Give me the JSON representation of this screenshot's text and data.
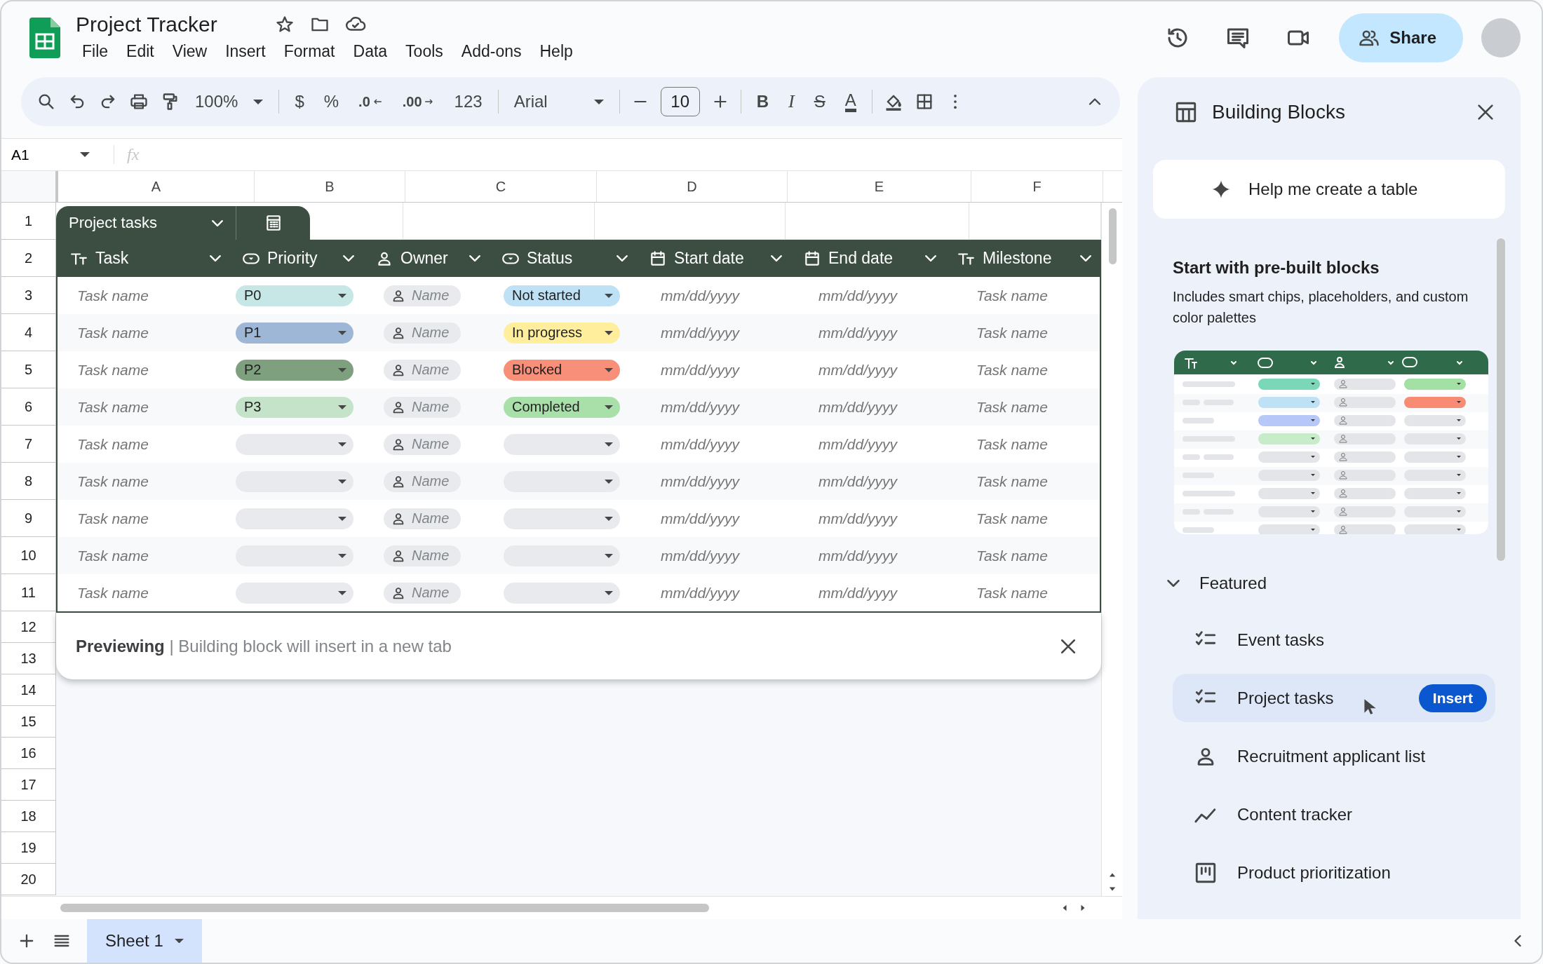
{
  "app": {
    "title": "Project Tracker",
    "menu": [
      "File",
      "Edit",
      "View",
      "Insert",
      "Format",
      "Data",
      "Tools",
      "Add-ons",
      "Help"
    ],
    "share": "Share"
  },
  "toolbar": {
    "zoom": "100%",
    "currency": "$",
    "percent": "%",
    "decrease_decimal": ".0",
    "increase_decimal": ".00",
    "number_format": "123",
    "font": "Arial",
    "font_size": "10",
    "bold": "B",
    "italic": "I",
    "strikethrough": "S",
    "text_color": "A"
  },
  "formula_bar": {
    "cell": "A1",
    "fx": "fx"
  },
  "columns": [
    "A",
    "B",
    "C",
    "D",
    "E",
    "F"
  ],
  "rows": [
    "1",
    "2",
    "3",
    "4",
    "5",
    "6",
    "7",
    "8",
    "9",
    "10",
    "11",
    "12",
    "13",
    "14",
    "15",
    "16",
    "17",
    "18",
    "19",
    "20"
  ],
  "table": {
    "name": "Project tasks",
    "columns": [
      {
        "kind": "text",
        "label": "Task"
      },
      {
        "kind": "dropdown",
        "label": "Priority"
      },
      {
        "kind": "person",
        "label": "Owner"
      },
      {
        "kind": "dropdown",
        "label": "Status"
      },
      {
        "kind": "date",
        "label": "Start date"
      },
      {
        "kind": "date",
        "label": "End date"
      },
      {
        "kind": "text",
        "label": "Milestone"
      }
    ],
    "rows": [
      {
        "task": "Task name",
        "priority": {
          "label": "P0",
          "color": "#c6e7e5"
        },
        "owner": "Name",
        "status": {
          "label": "Not started",
          "color": "#bfe1f6"
        },
        "start": "mm/dd/yyyy",
        "end": "mm/dd/yyyy",
        "milestone": "Task name"
      },
      {
        "task": "Task name",
        "priority": {
          "label": "P1",
          "color": "#9fb7d6"
        },
        "owner": "Name",
        "status": {
          "label": "In progress",
          "color": "#ffef9c"
        },
        "start": "mm/dd/yyyy",
        "end": "mm/dd/yyyy",
        "milestone": "Task name"
      },
      {
        "task": "Task name",
        "priority": {
          "label": "P2",
          "color": "#7fa07f"
        },
        "owner": "Name",
        "status": {
          "label": "Blocked",
          "color": "#f88f79"
        },
        "start": "mm/dd/yyyy",
        "end": "mm/dd/yyyy",
        "milestone": "Task name"
      },
      {
        "task": "Task name",
        "priority": {
          "label": "P3",
          "color": "#c4e3c8"
        },
        "owner": "Name",
        "status": {
          "label": "Completed",
          "color": "#a9dfa9"
        },
        "start": "mm/dd/yyyy",
        "end": "mm/dd/yyyy",
        "milestone": "Task name"
      },
      {
        "task": "Task name",
        "owner": "Name",
        "start": "mm/dd/yyyy",
        "end": "mm/dd/yyyy",
        "milestone": "Task name"
      },
      {
        "task": "Task name",
        "owner": "Name",
        "start": "mm/dd/yyyy",
        "end": "mm/dd/yyyy",
        "milestone": "Task name"
      },
      {
        "task": "Task name",
        "owner": "Name",
        "start": "mm/dd/yyyy",
        "end": "mm/dd/yyyy",
        "milestone": "Task name"
      },
      {
        "task": "Task name",
        "owner": "Name",
        "start": "mm/dd/yyyy",
        "end": "mm/dd/yyyy",
        "milestone": "Task name"
      },
      {
        "task": "Task name",
        "owner": "Name",
        "start": "mm/dd/yyyy",
        "end": "mm/dd/yyyy",
        "milestone": "Task name"
      }
    ]
  },
  "banner": {
    "text": "**Previewing** | Building block will insert in a new tab"
  },
  "panel": {
    "title": "Building Blocks",
    "help": "Help me create a table",
    "section_title": "Start with pre-built blocks",
    "description": "Includes smart chips, placeholders, and custom color palettes",
    "insert": "Insert",
    "featured": {
      "label": "Featured",
      "expanded": true,
      "items": [
        {
          "kind": "checklist",
          "label": "Event tasks",
          "selected": false
        },
        {
          "kind": "checklist",
          "label": "Project tasks",
          "selected": true
        },
        {
          "kind": "person",
          "label": "Recruitment applicant list",
          "selected": false
        },
        {
          "kind": "trend",
          "label": "Content tracker",
          "selected": false
        },
        {
          "kind": "board",
          "label": "Product prioritization",
          "selected": false
        }
      ]
    }
  },
  "sheets": [
    {
      "name": "Sheet 1",
      "selected": true
    }
  ]
}
